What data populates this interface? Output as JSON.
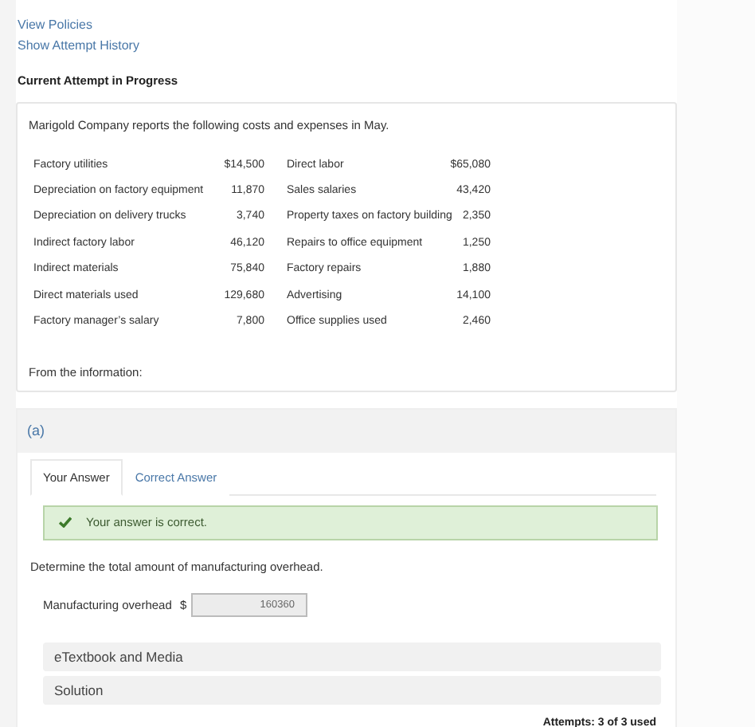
{
  "links": [
    "View Policies",
    "Show Attempt History"
  ],
  "attempt_heading": "Current Attempt in Progress",
  "problem": {
    "intro": "Marigold Company reports the following costs and expenses in May.",
    "rows": [
      {
        "label_1": "Factory utilities",
        "amount_1": "$14,500",
        "label_2": "Direct labor",
        "amount_2": "$65,080"
      },
      {
        "label_1": "Depreciation on factory equipment",
        "amount_1": "11,870",
        "label_2": "Sales salaries",
        "amount_2": "43,420"
      },
      {
        "label_1": "Depreciation on delivery trucks",
        "amount_1": "3,740",
        "label_2": "Property taxes on factory building",
        "amount_2": "2,350"
      },
      {
        "label_1": "Indirect factory labor",
        "amount_1": "46,120",
        "label_2": "Repairs to office equipment",
        "amount_2": "1,250"
      },
      {
        "label_1": "Indirect materials",
        "amount_1": "75,840",
        "label_2": "Factory repairs",
        "amount_2": "1,880"
      },
      {
        "label_1": "Direct materials used",
        "amount_1": "129,680",
        "label_2": "Advertising",
        "amount_2": "14,100"
      },
      {
        "label_1": "Factory manager’s salary",
        "amount_1": "7,800",
        "label_2": "Office supplies used",
        "amount_2": "2,460"
      }
    ],
    "footer": "From the information:"
  },
  "part": {
    "label": "(a)",
    "tabs": [
      {
        "label": "Your Answer",
        "selected": true
      },
      {
        "label": "Correct Answer",
        "selected": false
      }
    ],
    "alert": "Your answer is correct.",
    "question": "Determine the total amount of manufacturing overhead.",
    "answer": {
      "label": "Manufacturing overhead",
      "currency": "$",
      "value": "160360"
    },
    "panels": [
      "eTextbook and Media",
      "Solution"
    ],
    "attempts": "Attempts: 3 of 3 used"
  }
}
